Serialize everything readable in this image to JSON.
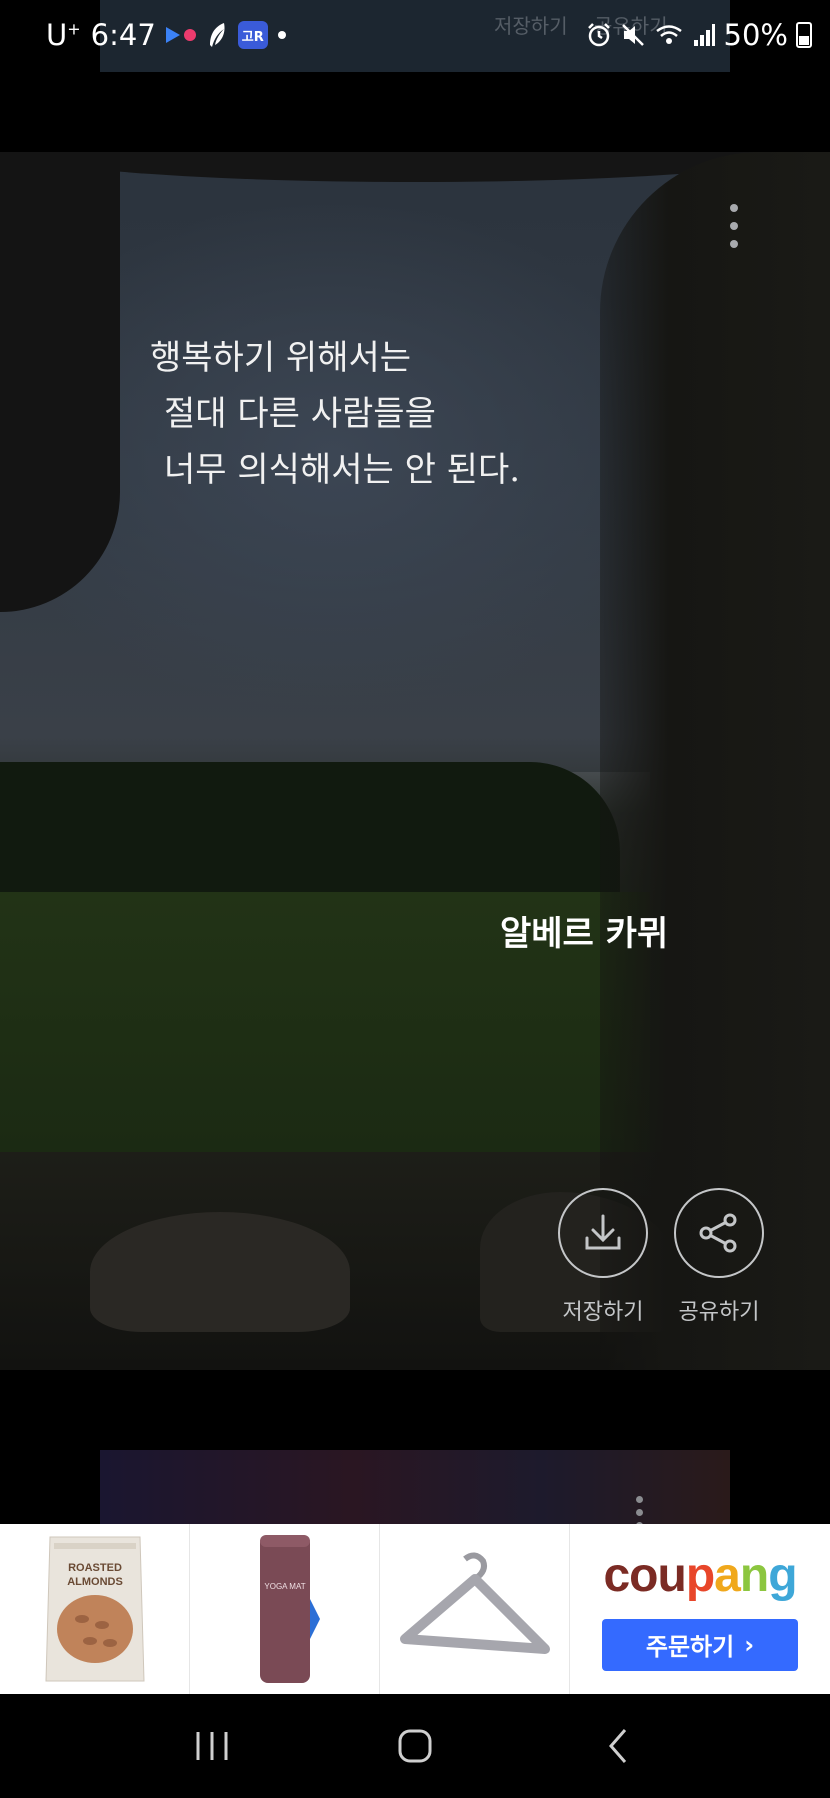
{
  "status_bar": {
    "carrier": "U",
    "carrier_sup": "+",
    "time": "6:47",
    "app_badge": "고R",
    "battery": "50%",
    "icons": [
      "play-icon",
      "feather-icon",
      "app-badge-icon",
      "notification-dot",
      "alarm-icon",
      "mute-icon",
      "wifi-icon",
      "signal-icon",
      "battery-icon"
    ]
  },
  "prev_card": {
    "save_label": "저장하기",
    "share_label": "공유하기"
  },
  "quote_card": {
    "quote_lines": [
      "행복하기 위해서는",
      "절대 다른 사람들을",
      "너무 의식해서는 안 된다."
    ],
    "author": "알베르 카뮈",
    "save_label": "저장하기",
    "share_label": "공유하기",
    "icons": [
      "more-vert-icon",
      "download-icon",
      "share-icon"
    ]
  },
  "ad": {
    "products": [
      {
        "name": "almonds-product",
        "label": "ROASTED ALMONDS"
      },
      {
        "name": "yoga-mat-product",
        "label": "YOGA MAT"
      },
      {
        "name": "hanger-product",
        "label": ""
      }
    ],
    "brand_letters": [
      "c",
      "o",
      "u",
      "p",
      "a",
      "n",
      "g"
    ],
    "brand_colors": [
      "#7b2b24",
      "#7b2b24",
      "#7b2b24",
      "#e8462a",
      "#f0a81c",
      "#8cc63f",
      "#3ea7d8"
    ],
    "order_label": "주문하기",
    "order_arrow": "›",
    "button_color": "#346aff"
  },
  "nav_bar": {
    "icons": [
      "recent-apps-icon",
      "home-icon",
      "back-icon"
    ]
  }
}
